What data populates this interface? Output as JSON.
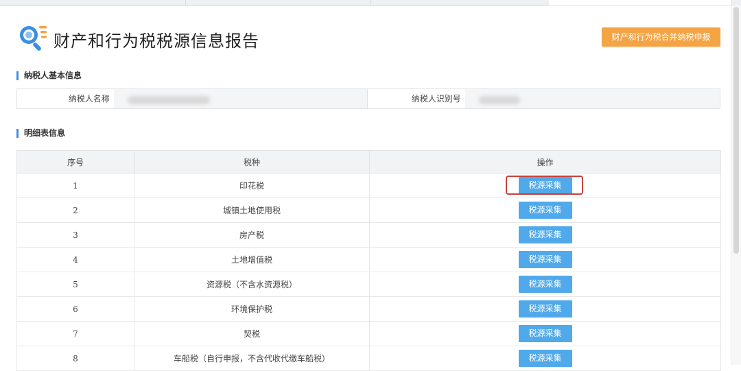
{
  "page": {
    "title": "财产和行为税税源信息报告",
    "merge_button": "财产和行为税合并纳税申报"
  },
  "basic_info": {
    "section_title": "纳税人基本信息",
    "name_label": "纳税人名称",
    "id_label": "纳税人识别号"
  },
  "detail": {
    "section_title": "明细表信息",
    "columns": [
      "序号",
      "税种",
      "操作"
    ],
    "rows": [
      {
        "no": "1",
        "tax": "印花税",
        "action": "税源采集"
      },
      {
        "no": "2",
        "tax": "城镇土地使用税",
        "action": "税源采集"
      },
      {
        "no": "3",
        "tax": "房产税",
        "action": "税源采集"
      },
      {
        "no": "4",
        "tax": "土地增值税",
        "action": "税源采集"
      },
      {
        "no": "5",
        "tax": "资源税（不含水资源税）",
        "action": "税源采集"
      },
      {
        "no": "6",
        "tax": "环境保护税",
        "action": "税源采集"
      },
      {
        "no": "7",
        "tax": "契税",
        "action": "税源采集"
      },
      {
        "no": "8",
        "tax": "车船税（自行申报，不含代收代缴车船税）",
        "action": "税源采集"
      }
    ]
  },
  "colors": {
    "accent_orange": "#f5a444",
    "button_blue": "#50a9ea",
    "section_bar": "#3a8ee6",
    "highlight_red": "#c8413a"
  },
  "icons": {
    "logo": "search-document-icon"
  }
}
